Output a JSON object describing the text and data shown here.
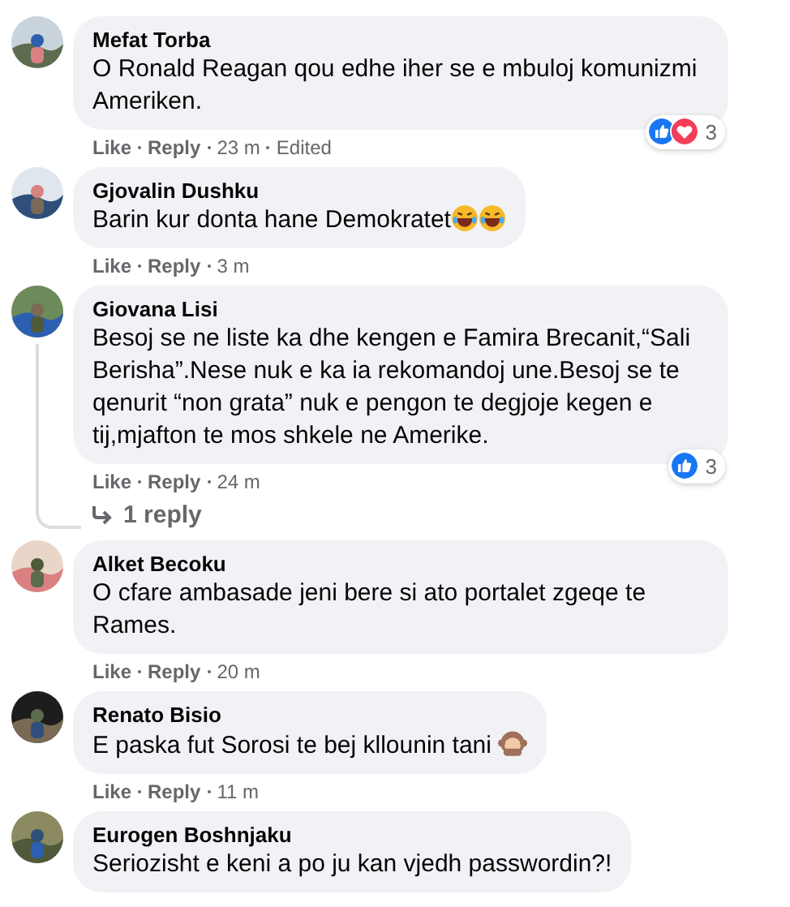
{
  "comments": [
    {
      "author": "Mefat Torba",
      "text": "O Ronald Reagan qou edhe iher se e mbuloj komunizmi Ameriken.",
      "like_label": "Like",
      "reply_label": "Reply",
      "time": "23 m",
      "edited": "Edited",
      "reactions": {
        "icons": [
          {
            "kind": "like"
          },
          {
            "kind": "love"
          }
        ],
        "count": "3"
      }
    },
    {
      "author": "Gjovalin Dushku",
      "text": "Barin kur donta hane Demokratet",
      "emojis": [
        {
          "kind": "laugh"
        },
        {
          "kind": "laugh"
        }
      ],
      "like_label": "Like",
      "reply_label": "Reply",
      "time": "3 m"
    },
    {
      "author": "Giovana Lisi",
      "text": "Besoj se ne liste ka dhe kengen e Famira Brecanit,“Sali Berisha”.Nese nuk e ka ia rekomandoj une.Besoj se te qenurit “non grata” nuk e pengon te degjoje kegen e tij,mjafton te mos shkele ne Amerike.",
      "like_label": "Like",
      "reply_label": "Reply",
      "time": "24 m",
      "reactions": {
        "icons": [
          {
            "kind": "like"
          }
        ],
        "count": "3"
      },
      "replies_label": "1 reply"
    },
    {
      "author": "Alket Becoku",
      "text": "O cfare ambasade jeni bere si ato portalet zgeqe te Rames.",
      "like_label": "Like",
      "reply_label": "Reply",
      "time": "20 m"
    },
    {
      "author": "Renato Bisio",
      "text": "E paska fut Sorosi te bej kllounin tani",
      "emojis": [
        {
          "kind": "monkey"
        }
      ],
      "like_label": "Like",
      "reply_label": "Reply",
      "time": "11 m"
    },
    {
      "author": "Eurogen Boshnjaku",
      "text": "Seriozisht e keni a po ju kan vjedh passwordin?!"
    }
  ]
}
